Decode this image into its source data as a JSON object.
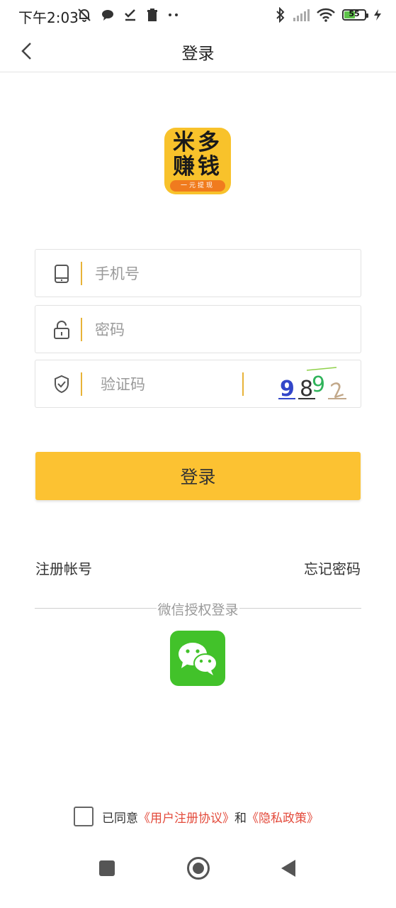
{
  "status_bar": {
    "time": "下午2:03",
    "battery_level": "55",
    "battery_fraction": 0.55
  },
  "header": {
    "title": "登录"
  },
  "logo": {
    "line1": "米多",
    "line2": "赚钱",
    "tagline": "一元提现",
    "colors": {
      "background": "#f8c22b",
      "strip": "#f07b1e"
    }
  },
  "form": {
    "phone_placeholder": "手机号",
    "password_placeholder": "密码",
    "captcha_placeholder": "验证码",
    "captcha_chars": [
      "9",
      "8",
      "9",
      "2"
    ]
  },
  "login_button": {
    "label": "登录",
    "color": "#fcc232"
  },
  "links": {
    "register": "注册帐号",
    "forgot_password": "忘记密码"
  },
  "wechat": {
    "label": "微信授权登录",
    "color": "#42c22a"
  },
  "agreement": {
    "prefix": "已同意",
    "user_agreement": "《用户注册协议》",
    "conjunction": "和",
    "privacy_policy": "《隐私政策》",
    "checked": false
  }
}
